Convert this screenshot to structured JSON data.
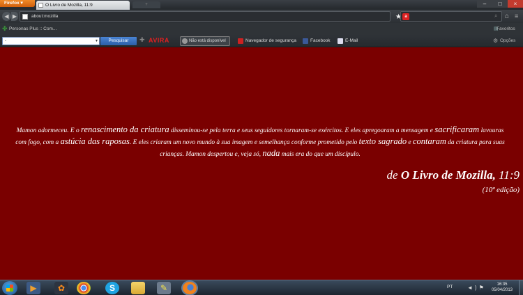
{
  "browser": {
    "app_button": "Firefox",
    "tab_title": "O Livro de Mozilla, 11:9",
    "url": "about:mozilla"
  },
  "bookmarks": {
    "item": "Personas Plus :: Com...",
    "favorites": "Favoritos"
  },
  "toolbar": {
    "search_value": "-",
    "search_button": "Pesquisar",
    "avira": "AVIRA",
    "status": "Não está disponível",
    "security": "Navegador de segurança",
    "facebook": "Facebook",
    "email": "E-Mail",
    "options": "Opções"
  },
  "content": {
    "verse": {
      "p1": "Mamon adormeceu. E o ",
      "b1": "renascimento da criatura",
      "p2": " disseminou-se pela terra e seus seguidores tornaram-se exércitos. E eles apregoaram a mensagem e ",
      "b2": "sacrificaram",
      "p3": " lavouras com fogo, com a ",
      "b3": "astúcia das raposas",
      "p4": ". E eles criaram um novo mundo à sua imagem e semelhança conforme prometido pelo ",
      "b4": "texto sagrado",
      "p5": " e ",
      "b5": "contaram",
      "p6": " da criatura para suas crianças. Mamon despertou e, veja só, ",
      "b6": "nada",
      "p7": " mais era do que um discípulo."
    },
    "citation_prefix": "de ",
    "citation_book": "O Livro de Mozilla,",
    "citation_ref": " 11:9",
    "edition": "(10ª edição)"
  },
  "taskbar": {
    "language": "PT",
    "time": "16:35",
    "date": "05/04/2013"
  },
  "colors": {
    "page_background": "#7a0000",
    "text": "#ffffff"
  }
}
